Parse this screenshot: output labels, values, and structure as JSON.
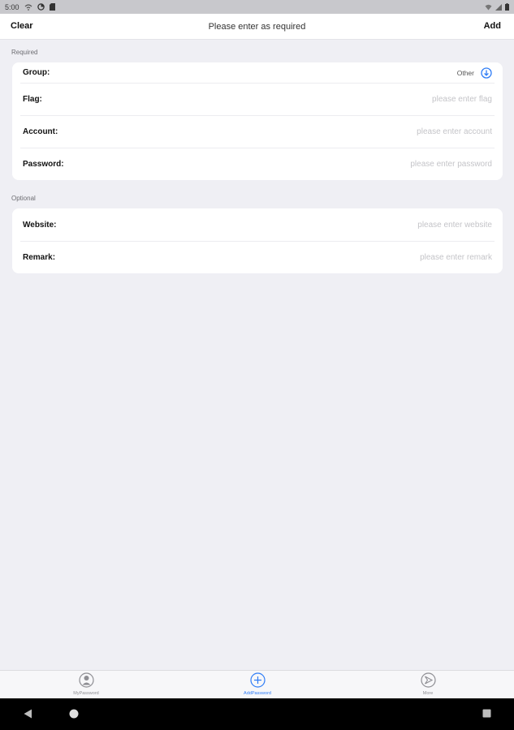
{
  "status_bar": {
    "time": "5:00"
  },
  "nav": {
    "left_label": "Clear",
    "title": "Please enter as required",
    "right_label": "Add"
  },
  "required_section": {
    "header": "Required",
    "group": {
      "label": "Group:",
      "value": "Other",
      "icon": "chevron-down-circle-icon"
    },
    "flag": {
      "label": "Flag:",
      "placeholder": "please enter flag"
    },
    "account": {
      "label": "Account:",
      "placeholder": "please enter account"
    },
    "password": {
      "label": "Password:",
      "placeholder": "please enter password"
    }
  },
  "optional_section": {
    "header": "Optional",
    "website": {
      "label": "Website:",
      "placeholder": "please enter website"
    },
    "remark": {
      "label": "Remark:",
      "placeholder": "please enter remark"
    }
  },
  "tabs": [
    {
      "label": "MyPassword",
      "icon": "person-icon",
      "active": false
    },
    {
      "label": "AddPassword",
      "icon": "plus-circle-icon",
      "active": true
    },
    {
      "label": "More",
      "icon": "compass-icon",
      "active": false
    }
  ],
  "colors": {
    "accent": "#2e7cf6",
    "background": "#efeff4",
    "placeholder": "#c4c4c8"
  }
}
